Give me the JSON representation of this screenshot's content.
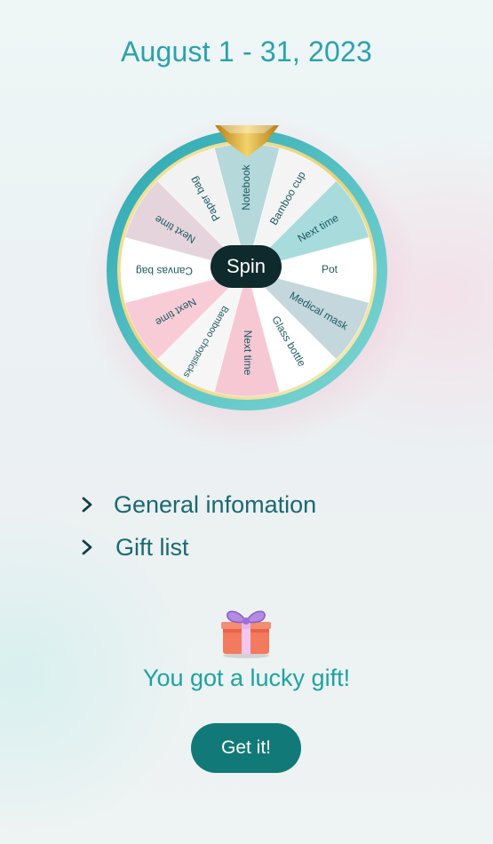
{
  "header": {
    "date_range": "August 1 - 31, 2023"
  },
  "wheel": {
    "spin_label": "Spin",
    "segments": [
      {
        "label": "Notebook",
        "color": "#b5d8da"
      },
      {
        "label": "Bamboo cup",
        "color": "#f4f4f4"
      },
      {
        "label": "Next time",
        "color": "#a8dcdc"
      },
      {
        "label": "Pot",
        "color": "#ffffff"
      },
      {
        "label": "Medical mask",
        "color": "#c3d7dc"
      },
      {
        "label": "Glass bottle",
        "color": "#ffffff"
      },
      {
        "label": "Next time",
        "color": "#f6c8d3"
      },
      {
        "label": "Bamboo chopsticks",
        "color": "#f6f6f6"
      },
      {
        "label": "Next time",
        "color": "#f8ccd6"
      },
      {
        "label": "Canvas bag",
        "color": "#ffffff"
      },
      {
        "label": "Next time",
        "color": "#e6d4dc"
      },
      {
        "label": "Paper bag",
        "color": "#f2f2f2"
      }
    ],
    "rim_color": "#5fc6c8",
    "pointer_color": "#d4a22c"
  },
  "accordion": {
    "items": [
      {
        "label": "General infomation",
        "icon": "chevron-right-icon"
      },
      {
        "label": "Gift list",
        "icon": "chevron-right-icon"
      }
    ]
  },
  "result": {
    "icon": "gift-icon",
    "message": "You got a lucky gift!",
    "button_label": "Get it!"
  },
  "colors": {
    "title": "#2aa2ad",
    "accordion_text": "#1a6970",
    "message": "#1ea3a0",
    "button": "#117a78"
  }
}
